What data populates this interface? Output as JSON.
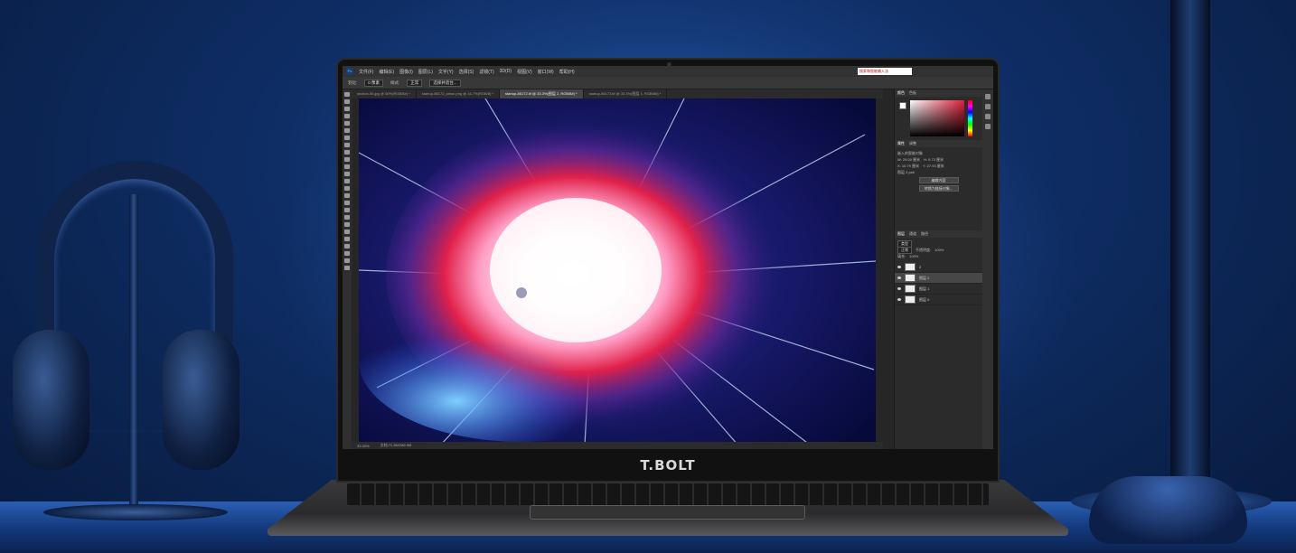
{
  "brand": {
    "logo_text": "T.BOLT"
  },
  "photoshop": {
    "menu": [
      "文件(F)",
      "编辑(E)",
      "图像(I)",
      "图层(L)",
      "文字(Y)",
      "选择(S)",
      "滤镜(T)",
      "3D(D)",
      "视图(V)",
      "窗口(W)",
      "帮助(H)"
    ],
    "search_placeholder": "搜索和智能输入法",
    "options": {
      "feather_label": "羽化:",
      "feather_value": "0 像素",
      "style_label": "样式:",
      "style_value": "正常",
      "select_mask": "选择并遮住..."
    },
    "tabs": [
      {
        "label": "section-06.jpg @ 50%(RGB/8#) *",
        "active": false
      },
      {
        "label": "startup-86172_clean.png @ 16.7%(RGB/8) *",
        "active": false
      },
      {
        "label": "startup-86172.tif @ 33.3%(图层 2, RGB/8#) *",
        "active": true
      },
      {
        "label": "startup-86173.tif @ 33.3%(图层 1, RGB/8#) *",
        "active": false
      }
    ],
    "status": {
      "zoom": "33.33%",
      "doc": "文档:71.3M/286.9M"
    },
    "panels": {
      "color_tabs": [
        "颜色",
        "色板"
      ],
      "props_tabs": [
        "属性",
        "调整"
      ],
      "props_title": "嵌入的智能对象",
      "props_w": "W: 29.00 厘米",
      "props_h": "H: 9.73 厘米",
      "props_x": "X: 10.79 厘米",
      "props_y": "Y: 27.93 厘米",
      "layer_name_label": "图层 2.psb",
      "btn_edit": "编辑内容",
      "btn_convert": "转换为链接对象...",
      "layers_tabs": [
        "图层",
        "通道",
        "路径"
      ],
      "layers_kind": "类型",
      "blend_mode": "正常",
      "opacity_label": "不透明度:",
      "opacity_value": "100%",
      "fill_label": "填充:",
      "fill_value": "100%",
      "layers": [
        {
          "name": "2",
          "active": false
        },
        {
          "name": "图层 2",
          "active": true
        },
        {
          "name": "图层 1",
          "active": false
        },
        {
          "name": "图层 0",
          "active": false
        }
      ]
    }
  },
  "colors": {
    "ps_dark": "#262626",
    "accent_blue": "#31a8ff"
  }
}
